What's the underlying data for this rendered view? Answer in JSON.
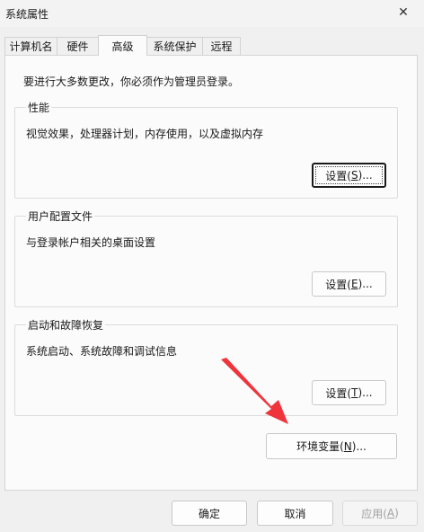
{
  "window": {
    "title": "系统属性"
  },
  "tabs": [
    {
      "label": "计算机名"
    },
    {
      "label": "硬件"
    },
    {
      "label": "高级",
      "active": true
    },
    {
      "label": "系统保护"
    },
    {
      "label": "远程"
    }
  ],
  "notice": "要进行大多数更改，你必须作为管理员登录。",
  "groups": {
    "performance": {
      "title": "性能",
      "desc": "视觉效果，处理器计划，内存使用，以及虚拟内存",
      "button": {
        "prefix": "设置(",
        "accel": "S",
        "suffix": ")..."
      }
    },
    "profile": {
      "title": "用户配置文件",
      "desc": "与登录帐户相关的桌面设置",
      "button": {
        "prefix": "设置(",
        "accel": "E",
        "suffix": ")..."
      }
    },
    "startup": {
      "title": "启动和故障恢复",
      "desc": "系统启动、系统故障和调试信息",
      "button": {
        "prefix": "设置(",
        "accel": "T",
        "suffix": ")..."
      }
    }
  },
  "env_button": {
    "prefix": "环境变量(",
    "accel": "N",
    "suffix": ")..."
  },
  "footer": {
    "ok": "确定",
    "cancel": "取消",
    "apply": {
      "prefix": "应用(",
      "accel": "A",
      "suffix": ")"
    }
  },
  "annotation": {
    "arrow_color": "#f0343c"
  },
  "icons": {
    "close": "close-icon"
  }
}
